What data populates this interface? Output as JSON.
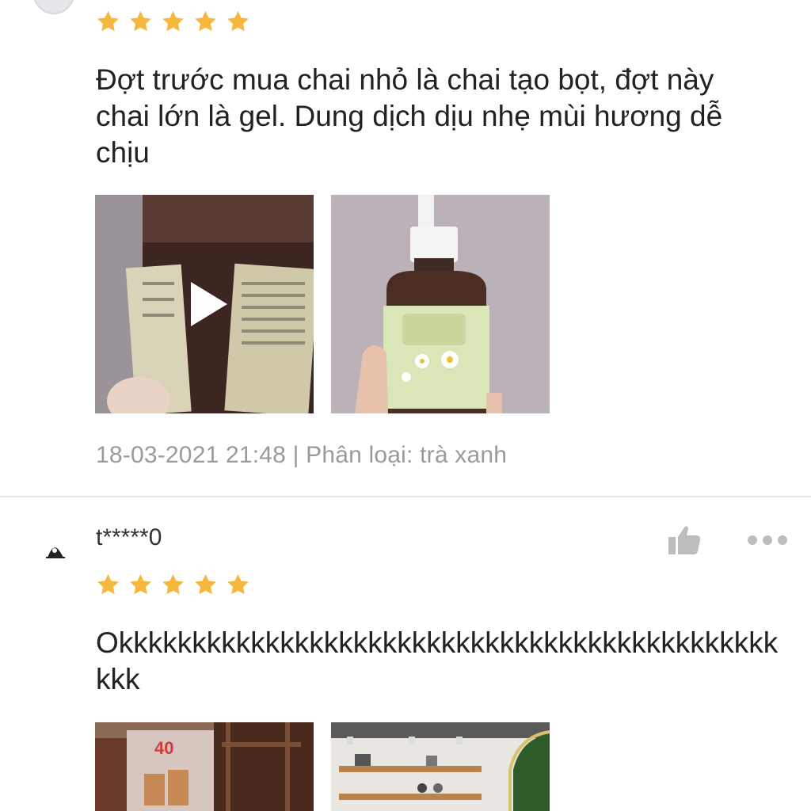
{
  "colors": {
    "star": "#f6b73c",
    "meta_text": "#9a9a9a",
    "divider": "#e6e6e6"
  },
  "reviews": [
    {
      "rating": 5,
      "text": "Đợt trước mua chai nhỏ là chai tạo bọt, đợt này chai lớn là gel. Dung dịch dịu nhẹ mùi hương dễ chịu",
      "media": [
        "video-thumbnail",
        "bottle-photo"
      ],
      "meta": "18-03-2021 21:48 | Phân loại: trà xanh"
    },
    {
      "user": "t*****0",
      "rating": 5,
      "text": "Okkkkkkkkkkkkkkkkkkkkkkkkkkkkkkkkkkkkkkkkkkkkkkkk",
      "media": [
        "cafe-photo",
        "shelf-photo"
      ]
    }
  ],
  "icons": {
    "like": "thumbs-up-icon",
    "more": "more-dots-icon",
    "play": "play-icon"
  }
}
